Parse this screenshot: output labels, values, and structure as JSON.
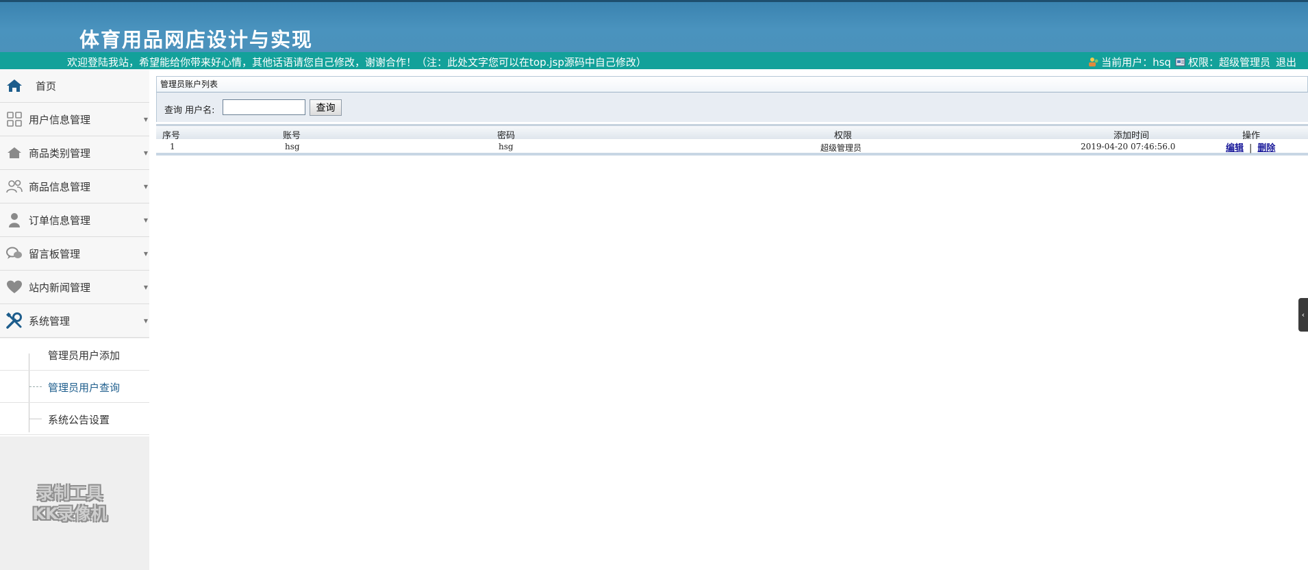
{
  "header": {
    "title": "体育用品网店设计与实现",
    "welcome": "欢迎登陆我站，希望能给你带来好心情，其他话语请您自己修改，谢谢合作！（注：此处文字您可以在top.jsp源码中自己修改）",
    "current_user_label": "当前用户：hsq",
    "role_label": "权限：超级管理员",
    "logout": "退出"
  },
  "sidebar": {
    "home": "首页",
    "items": [
      {
        "label": "用户信息管理",
        "icon": "grid-icon"
      },
      {
        "label": "商品类别管理",
        "icon": "home-icon"
      },
      {
        "label": "商品信息管理",
        "icon": "users-icon"
      },
      {
        "label": "订单信息管理",
        "icon": "person-icon"
      },
      {
        "label": "留言板管理",
        "icon": "chat-icon"
      },
      {
        "label": "站内新闻管理",
        "icon": "heart-icon"
      },
      {
        "label": "系统管理",
        "icon": "tools-icon"
      }
    ],
    "submenu": [
      {
        "label": "管理员用户添加"
      },
      {
        "label": "管理员用户查询"
      },
      {
        "label": "系统公告设置"
      }
    ],
    "watermark_line1": "录制工具",
    "watermark_line2": "KK录像机"
  },
  "main": {
    "panel_title": "管理员账户列表",
    "search": {
      "label": "查询  用户名:",
      "value": "",
      "button": "查询"
    },
    "table": {
      "columns": [
        "序号",
        "账号",
        "密码",
        "权限",
        "添加时间",
        "操作"
      ],
      "rows": [
        {
          "index": "1",
          "account": "hsg",
          "password": "hsg",
          "role": "超级管理员",
          "added": "2019-04-20 07:46:56.0",
          "edit": "编辑",
          "sep": "|",
          "delete": "删除"
        }
      ]
    }
  },
  "colors": {
    "header_blue": "#4a93be",
    "bar_teal": "#13a19a",
    "link_blue": "#1a1a9a"
  }
}
